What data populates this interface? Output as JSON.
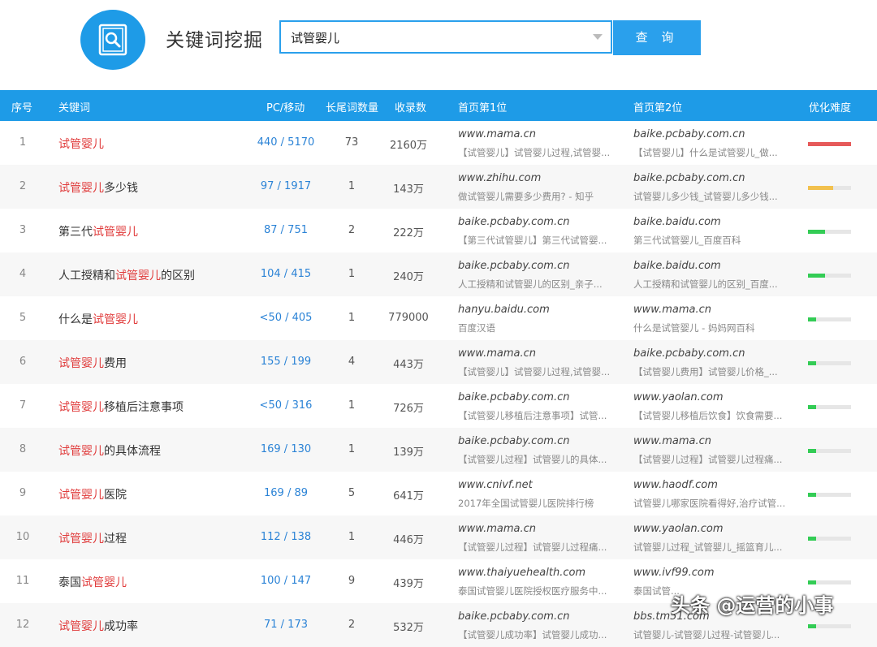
{
  "header": {
    "title": "关键词挖掘",
    "search_value": "试管婴儿",
    "search_button": "查 询"
  },
  "columns": {
    "idx": "序号",
    "keyword": "关键词",
    "pc_mobile": "PC/移动",
    "long_tail": "长尾词数量",
    "records": "收录数",
    "first": "首页第1位",
    "second": "首页第2位",
    "difficulty": "优化难度"
  },
  "colors": {
    "accent": "#1e9be7",
    "highlight": "#e03b3b",
    "bar_red": "#e65a5a",
    "bar_yellow": "#f2c14e",
    "bar_green": "#33cc55"
  },
  "rows": [
    {
      "idx": "1",
      "pre": "",
      "hl": "试管婴儿",
      "post": "",
      "pc": "440 / 5170",
      "lt": "73",
      "rec": "2160万",
      "s1": "www.mama.cn",
      "d1": "【试管婴儿】试管婴儿过程,试管婴...",
      "s2": "baike.pcbaby.com.cn",
      "d2": "【试管婴儿】什么是试管婴儿_做...",
      "difficulty": 1.0,
      "bar": "bar_red"
    },
    {
      "idx": "2",
      "pre": "",
      "hl": "试管婴儿",
      "post": "多少钱",
      "pc": "97 / 1917",
      "lt": "1",
      "rec": "143万",
      "s1": "www.zhihu.com",
      "d1": "做试管婴儿需要多少费用? - 知乎",
      "s2": "baike.pcbaby.com.cn",
      "d2": "试管婴儿多少钱_试管婴儿多少钱...",
      "difficulty": 0.58,
      "bar": "bar_yellow"
    },
    {
      "idx": "3",
      "pre": "第三代",
      "hl": "试管婴儿",
      "post": "",
      "pc": "87 / 751",
      "lt": "2",
      "rec": "222万",
      "s1": "baike.pcbaby.com.cn",
      "d1": "【第三代试管婴儿】第三代试管婴...",
      "s2": "baike.baidu.com",
      "d2": "第三代试管婴儿_百度百科",
      "difficulty": 0.4,
      "bar": "bar_green"
    },
    {
      "idx": "4",
      "pre": "人工授精和",
      "hl": "试管婴儿",
      "post": "的区别",
      "pc": "104 / 415",
      "lt": "1",
      "rec": "240万",
      "s1": "baike.pcbaby.com.cn",
      "d1": "人工授精和试管婴儿的区别_亲子...",
      "s2": "baike.baidu.com",
      "d2": "人工授精和试管婴儿的区别_百度...",
      "difficulty": 0.4,
      "bar": "bar_green"
    },
    {
      "idx": "5",
      "pre": "什么是",
      "hl": "试管婴儿",
      "post": "",
      "pc": "<50 / 405",
      "lt": "1",
      "rec": "779000",
      "s1": "hanyu.baidu.com",
      "d1": "百度汉语",
      "s2": "www.mama.cn",
      "d2": "什么是试管婴儿 - 妈妈网百科",
      "difficulty": 0.18,
      "bar": "bar_green"
    },
    {
      "idx": "6",
      "pre": "",
      "hl": "试管婴儿",
      "post": "费用",
      "pc": "155 / 199",
      "lt": "4",
      "rec": "443万",
      "s1": "www.mama.cn",
      "d1": "【试管婴儿】试管婴儿过程,试管婴...",
      "s2": "baike.pcbaby.com.cn",
      "d2": "【试管婴儿费用】试管婴儿价格_...",
      "difficulty": 0.18,
      "bar": "bar_green"
    },
    {
      "idx": "7",
      "pre": "",
      "hl": "试管婴儿",
      "post": "移植后注意事项",
      "pc": "<50 / 316",
      "lt": "1",
      "rec": "726万",
      "s1": "baike.pcbaby.com.cn",
      "d1": "【试管婴儿移植后注意事项】试管...",
      "s2": "www.yaolan.com",
      "d2": "【试管婴儿移植后饮食】饮食需要...",
      "difficulty": 0.18,
      "bar": "bar_green"
    },
    {
      "idx": "8",
      "pre": "",
      "hl": "试管婴儿",
      "post": "的具体流程",
      "pc": "169 / 130",
      "lt": "1",
      "rec": "139万",
      "s1": "baike.pcbaby.com.cn",
      "d1": "【试管婴儿过程】试管婴儿的具体...",
      "s2": "www.mama.cn",
      "d2": "【试管婴儿过程】试管婴儿过程痛...",
      "difficulty": 0.18,
      "bar": "bar_green"
    },
    {
      "idx": "9",
      "pre": "",
      "hl": "试管婴儿",
      "post": "医院",
      "pc": "169 / 89",
      "lt": "5",
      "rec": "641万",
      "s1": "www.cnivf.net",
      "d1": "2017年全国试管婴儿医院排行榜",
      "s2": "www.haodf.com",
      "d2": "试管婴儿哪家医院看得好,治疗试管...",
      "difficulty": 0.18,
      "bar": "bar_green"
    },
    {
      "idx": "10",
      "pre": "",
      "hl": "试管婴儿",
      "post": "过程",
      "pc": "112 / 138",
      "lt": "1",
      "rec": "446万",
      "s1": "www.mama.cn",
      "d1": "【试管婴儿过程】试管婴儿过程痛...",
      "s2": "www.yaolan.com",
      "d2": "试管婴儿过程_试管婴儿_摇篮育儿...",
      "difficulty": 0.18,
      "bar": "bar_green"
    },
    {
      "idx": "11",
      "pre": "泰国",
      "hl": "试管婴儿",
      "post": "",
      "pc": "100 / 147",
      "lt": "9",
      "rec": "439万",
      "s1": "www.thaiyuehealth.com",
      "d1": "泰国试管婴儿医院授权医疗服务中...",
      "s2": "www.ivf99.com",
      "d2": "泰国试管...",
      "difficulty": 0.18,
      "bar": "bar_green"
    },
    {
      "idx": "12",
      "pre": "",
      "hl": "试管婴儿",
      "post": "成功率",
      "pc": "71 / 173",
      "lt": "2",
      "rec": "532万",
      "s1": "baike.pcbaby.com.cn",
      "d1": "【试管婴儿成功率】试管婴儿成功...",
      "s2": "bbs.tm51.com",
      "d2": "试管婴儿-试管婴儿过程-试管婴儿...",
      "difficulty": 0.18,
      "bar": "bar_green"
    }
  ],
  "watermark": "头条 @运营的小事"
}
